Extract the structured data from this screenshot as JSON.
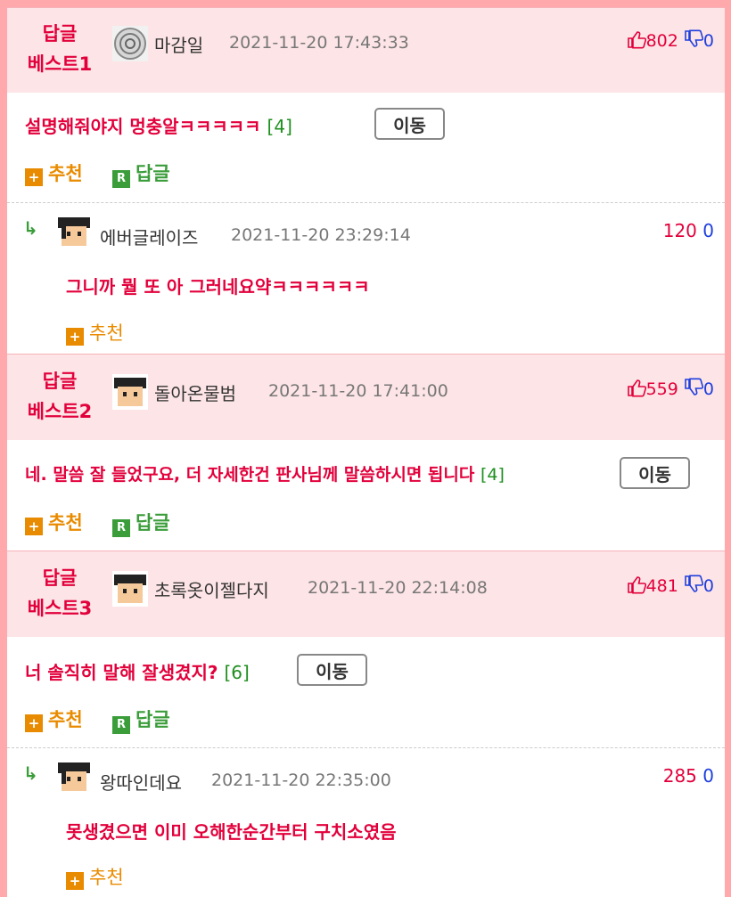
{
  "best1": {
    "label_line1": "답글",
    "label_line2": "베스트1",
    "nick": "마감일",
    "date": "2021-11-20 17:43:33",
    "up": "802",
    "down": "0",
    "text": "설명해줘야지 멍충알ㅋㅋㅋㅋㅋ",
    "count": "[4]",
    "move": "이동",
    "recommend": "추천",
    "reply": "답글",
    "sub": {
      "nick": "에버글레이즈",
      "date": "2021-11-20 23:29:14",
      "up": "120",
      "down": "0",
      "text": "그니까 뭘 또 아 그러네요약ㅋㅋㅋㅋㅋㅋ",
      "recommend": "추천"
    }
  },
  "best2": {
    "label_line1": "답글",
    "label_line2": "베스트2",
    "nick": "돌아온물범",
    "date": "2021-11-20 17:41:00",
    "up": "559",
    "down": "0",
    "text": "네. 말씀 잘 들었구요, 더 자세한건 판사님께 말씀하시면 됩니다",
    "count": "[4]",
    "move": "이동",
    "recommend": "추천",
    "reply": "답글"
  },
  "best3": {
    "label_line1": "답글",
    "label_line2": "베스트3",
    "nick": "초록옷이젤다지",
    "date": "2021-11-20 22:14:08",
    "up": "481",
    "down": "0",
    "text": "너 솔직히 말해 잘생겼지?",
    "count": "[6]",
    "move": "이동",
    "recommend": "추천",
    "reply": "답글",
    "sub": {
      "nick": "왕따인데요",
      "date": "2021-11-20 22:35:00",
      "up": "285",
      "down": "0",
      "text": "못생겼으면 이미 오해한순간부터 구치소였음",
      "recommend": "추천"
    }
  },
  "icons": {
    "reply_arrow": "reply-arrow-icon",
    "thumb_up": "thumb-up-icon",
    "thumb_down": "thumb-down-icon",
    "plus": "plus-square-icon",
    "reply_badge": "reply-badge-icon"
  },
  "colors": {
    "accent_red": "#e2003b",
    "header_bg": "#fde4e6",
    "frame": "#ffa9ad",
    "recommend_orange": "#e98b00",
    "reply_green": "#3a9d3a",
    "down_blue": "#1f3fdd"
  }
}
